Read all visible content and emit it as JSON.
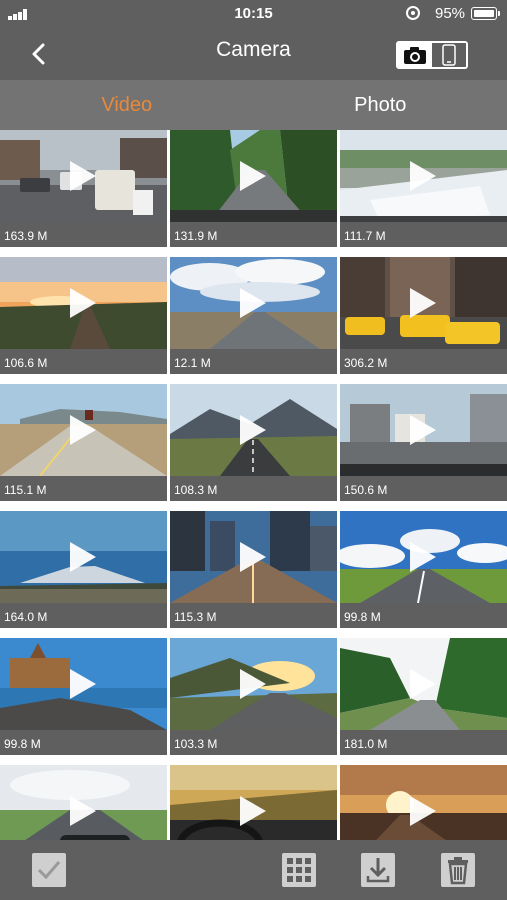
{
  "status_bar": {
    "time": "10:15",
    "battery_percent": "95%",
    "battery_level": 0.95
  },
  "nav": {
    "title": "Camera",
    "back_icon": "chevron-left-icon",
    "mode_toggle": {
      "active": "camera-icon",
      "inactive": "phone-icon"
    }
  },
  "tabs": [
    {
      "label": "Video",
      "active": true
    },
    {
      "label": "Photo",
      "active": false
    }
  ],
  "videos": [
    {
      "size": "163.9 M",
      "scene": "city-traffic"
    },
    {
      "size": "131.9 M",
      "scene": "forest-road"
    },
    {
      "size": "111.7 M",
      "scene": "highway-car-hood"
    },
    {
      "size": "106.6 M",
      "scene": "sunset-road"
    },
    {
      "size": "12.1 M",
      "scene": "cloudy-road"
    },
    {
      "size": "306.2 M",
      "scene": "taxis-city"
    },
    {
      "size": "115.1 M",
      "scene": "desert-road"
    },
    {
      "size": "108.3 M",
      "scene": "mountain-road"
    },
    {
      "size": "150.6 M",
      "scene": "urban-dashcam"
    },
    {
      "size": "164.0 M",
      "scene": "snow-mountain"
    },
    {
      "size": "115.3 M",
      "scene": "night-city-road"
    },
    {
      "size": "99.8 M",
      "scene": "blue-sky-road"
    },
    {
      "size": "99.8 M",
      "scene": "lakeside-castle"
    },
    {
      "size": "103.3 M",
      "scene": "hill-sunrise-road"
    },
    {
      "size": "181.0 M",
      "scene": "green-hills-road"
    },
    {
      "size": "",
      "scene": "sports-car"
    },
    {
      "size": "",
      "scene": "driving-wheel"
    },
    {
      "size": "",
      "scene": "sun-flare-road"
    }
  ],
  "toolbar": {
    "select_icon": "checkmark-icon",
    "grid_icon": "grid-icon",
    "download_icon": "download-icon",
    "delete_icon": "trash-icon"
  },
  "colors": {
    "background": "#5f5f5f",
    "tab_bar": "#737373",
    "accent": "#e8893b",
    "text": "#ffffff"
  }
}
